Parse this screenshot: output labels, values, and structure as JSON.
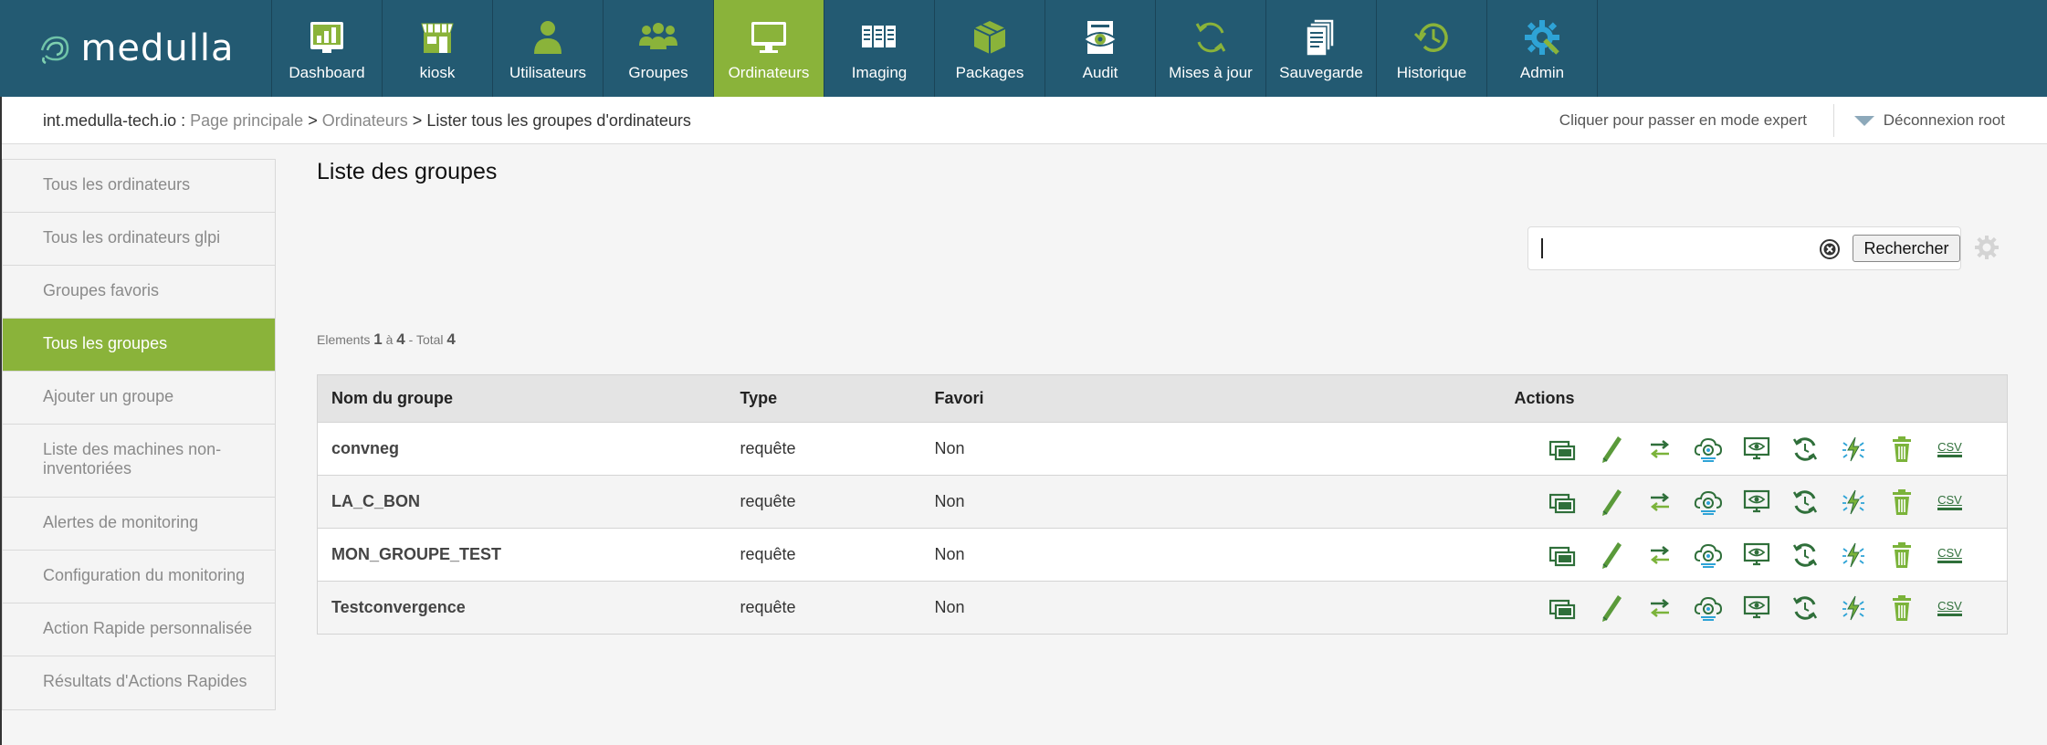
{
  "app": {
    "logo_text": "medulla"
  },
  "nav": [
    {
      "label": "Dashboard",
      "icon": "dashboard-icon"
    },
    {
      "label": "kiosk",
      "icon": "kiosk-icon"
    },
    {
      "label": "Utilisateurs",
      "icon": "user-icon"
    },
    {
      "label": "Groupes",
      "icon": "groups-icon"
    },
    {
      "label": "Ordinateurs",
      "icon": "computer-icon",
      "active": true
    },
    {
      "label": "Imaging",
      "icon": "imaging-icon"
    },
    {
      "label": "Packages",
      "icon": "packages-icon"
    },
    {
      "label": "Audit",
      "icon": "audit-icon"
    },
    {
      "label": "Mises à jour",
      "icon": "updates-icon"
    },
    {
      "label": "Sauvegarde",
      "icon": "backup-icon"
    },
    {
      "label": "Historique",
      "icon": "history-icon"
    },
    {
      "label": "Admin",
      "icon": "admin-gear-icon"
    }
  ],
  "breadcrumb": {
    "host": "int.medulla-tech.io :",
    "home": "Page principale",
    "sep1": ">",
    "section": "Ordinateurs",
    "sep2": ">",
    "current": "Lister tous les groupes d'ordinateurs"
  },
  "header": {
    "expert_mode": "Cliquer pour passer en mode expert",
    "logout": "Déconnexion root"
  },
  "sidebar": {
    "items": [
      {
        "label": "Tous les ordinateurs"
      },
      {
        "label": "Tous les ordinateurs glpi"
      },
      {
        "label": "Groupes favoris"
      },
      {
        "label": "Tous les groupes",
        "active": true
      },
      {
        "label": "Ajouter un groupe"
      },
      {
        "label": "Liste des machines non-inventoriées"
      },
      {
        "label": "Alertes de monitoring"
      },
      {
        "label": "Configuration du monitoring"
      },
      {
        "label": "Action Rapide personnalisée"
      },
      {
        "label": "Résultats d'Actions Rapides"
      }
    ]
  },
  "main": {
    "title": "Liste des groupes",
    "search": {
      "value": "",
      "button": "Rechercher"
    },
    "count": {
      "prefix": "Elements",
      "from": "1",
      "to_word": "à",
      "to": "4",
      "total_word": "- Total",
      "total": "4"
    },
    "table": {
      "headers": [
        "Nom du groupe",
        "Type",
        "Favori",
        "Actions"
      ],
      "rows": [
        {
          "name": "convneg",
          "type": "requête",
          "favori": "Non"
        },
        {
          "name": "LA_C_BON",
          "type": "requête",
          "favori": "Non"
        },
        {
          "name": "MON_GROUPE_TEST",
          "type": "requête",
          "favori": "Non"
        },
        {
          "name": "Testconvergence",
          "type": "requête",
          "favori": "Non"
        }
      ],
      "action_icons": [
        "display-group-icon",
        "edit-pencil-icon",
        "transfer-arrows-icon",
        "cloud-deploy-icon",
        "monitor-view-icon",
        "update-cycle-icon",
        "quick-action-flash-icon",
        "delete-trash-icon",
        "csv-export-icon"
      ],
      "csv_label": "CSV"
    }
  },
  "colors": {
    "topbar": "#235a72",
    "accent_green": "#8ab33a",
    "icon_green": "#2f6f3a"
  }
}
